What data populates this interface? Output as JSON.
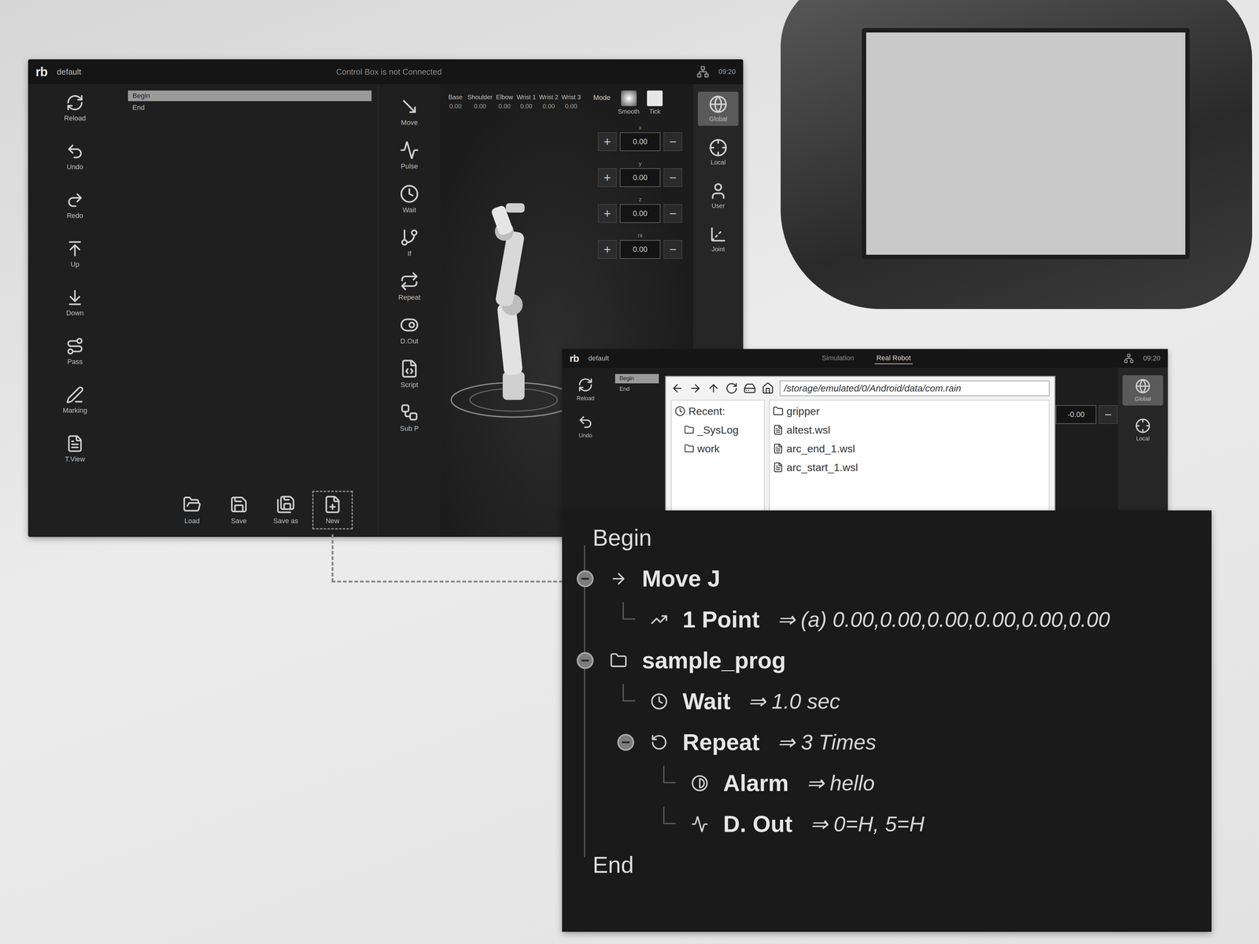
{
  "main_screen": {
    "logo": "rb",
    "title": "default",
    "status": "Control Box is not Connected",
    "time": "09:20",
    "left_tools": [
      {
        "label": "Reload"
      },
      {
        "label": "Undo"
      },
      {
        "label": "Redo"
      },
      {
        "label": "Up"
      },
      {
        "label": "Down"
      },
      {
        "label": "Pass"
      },
      {
        "label": "Marking"
      },
      {
        "label": "T.View"
      }
    ],
    "program_list": [
      {
        "label": "Begin",
        "selected": true
      },
      {
        "label": "End",
        "selected": false
      }
    ],
    "commands": [
      {
        "label": "Move"
      },
      {
        "label": "Pulse"
      },
      {
        "label": "Wait"
      },
      {
        "label": "If"
      },
      {
        "label": "Repeat"
      },
      {
        "label": "D.Out"
      },
      {
        "label": "Script"
      },
      {
        "label": "Sub P"
      }
    ],
    "readouts": [
      {
        "label": "Base",
        "value": "0.00"
      },
      {
        "label": "Shoulder",
        "value": "0.00"
      },
      {
        "label": "Elbow",
        "value": "0.00"
      },
      {
        "label": "Wrist 1",
        "value": "0.00"
      },
      {
        "label": "Wrist 2",
        "value": "0.00"
      },
      {
        "label": "Wrist 3",
        "value": "0.00"
      }
    ],
    "mode": {
      "label": "Mode",
      "options": [
        {
          "label": "Smooth",
          "selected": true
        },
        {
          "label": "Tick",
          "selected": false
        }
      ]
    },
    "jog": [
      {
        "label": "x",
        "value": "0.00",
        "plus": "+",
        "minus": "−"
      },
      {
        "label": "y",
        "value": "0.00",
        "plus": "+",
        "minus": "−"
      },
      {
        "label": "z",
        "value": "0.00",
        "plus": "+",
        "minus": "−"
      },
      {
        "label": "rx",
        "value": "0.00",
        "plus": "+",
        "minus": "−"
      }
    ],
    "frames": [
      {
        "label": "Global",
        "selected": true
      },
      {
        "label": "Local",
        "selected": false
      },
      {
        "label": "User",
        "selected": false
      },
      {
        "label": "Joint",
        "selected": false
      }
    ],
    "file_actions": [
      {
        "label": "Load",
        "highlighted": false
      },
      {
        "label": "Save",
        "highlighted": false
      },
      {
        "label": "Save as",
        "highlighted": false
      },
      {
        "label": "New",
        "highlighted": true
      }
    ]
  },
  "file_screen": {
    "logo": "rb",
    "title": "default",
    "modes": [
      {
        "label": "Simulation",
        "selected": false
      },
      {
        "label": "Real Robot",
        "selected": true
      }
    ],
    "time": "09:20",
    "left_tools": [
      {
        "label": "Reload"
      },
      {
        "label": "Undo"
      }
    ],
    "program_list": [
      {
        "label": "Begin",
        "selected": true
      },
      {
        "label": "End",
        "selected": false
      }
    ],
    "jog_value": "-0.00",
    "jog_minus": "−",
    "frames": [
      {
        "label": "Global",
        "selected": true
      },
      {
        "label": "Local",
        "selected": false
      }
    ],
    "dialog": {
      "path": "/storage/emulated/0/Android/data/com.rain",
      "recent_label": "Recent:",
      "places": [
        {
          "name": "_SysLog"
        },
        {
          "name": "work"
        }
      ],
      "files": [
        {
          "name": "gripper",
          "kind": "folder"
        },
        {
          "name": "altest.wsl",
          "kind": "file"
        },
        {
          "name": "arc_end_1.wsl",
          "kind": "file"
        },
        {
          "name": "arc_start_1.wsl",
          "kind": "file"
        }
      ]
    }
  },
  "program_tree": {
    "begin": "Begin",
    "end": "End",
    "items": [
      {
        "label": "Move J",
        "kind": "move",
        "expanded": true,
        "children": [
          {
            "label": "1 Point",
            "value": "⇒ (a) 0.00,0.00,0.00,0.00,0.00,0.00",
            "kind": "point"
          }
        ]
      },
      {
        "label": "sample_prog",
        "kind": "folder",
        "expanded": true,
        "children": [
          {
            "label": "Wait",
            "value": "⇒ 1.0 sec",
            "kind": "wait"
          },
          {
            "label": "Repeat",
            "value": "⇒ 3 Times",
            "kind": "repeat",
            "expanded": true,
            "children": [
              {
                "label": "Alarm",
                "value": "⇒ hello",
                "kind": "alarm"
              },
              {
                "label": "D. Out",
                "value": "⇒ 0=H, 5=H",
                "kind": "dout"
              }
            ]
          }
        ]
      }
    ]
  }
}
